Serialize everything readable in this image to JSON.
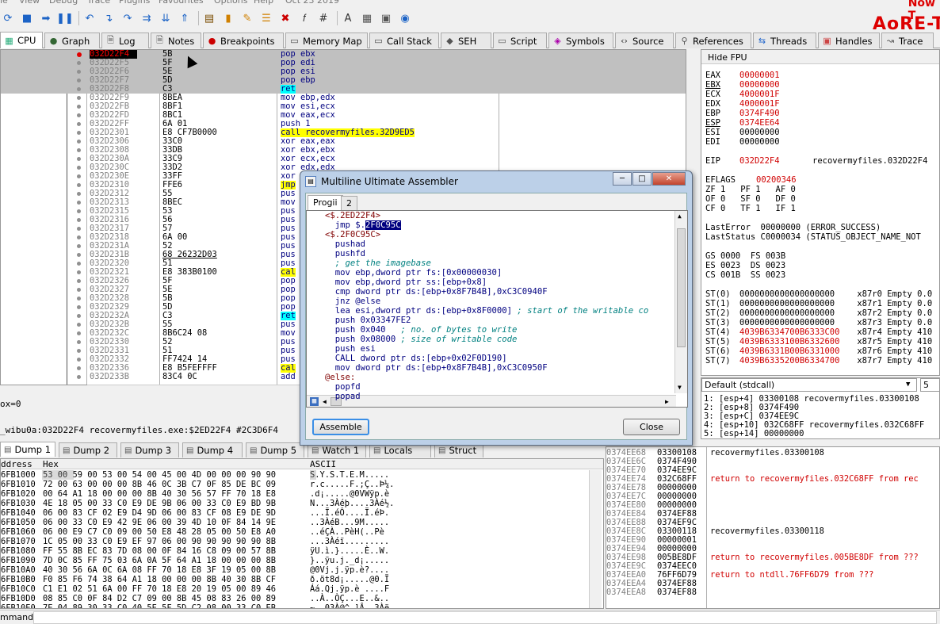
{
  "menubar": {
    "items": [
      "ie",
      "View",
      "Debug",
      "Trace",
      "Plugins",
      "Favourites",
      "Options",
      "Help",
      "Oct 23 2019"
    ]
  },
  "logo": {
    "line1": "Now T",
    "line2": "AoRE-T"
  },
  "toolbar": {
    "icons": [
      "refresh-icon",
      "stop-icon",
      "run-icon",
      "pause-icon",
      "restart-icon",
      "step-into-icon",
      "step-over-icon",
      "trace-icon",
      "animate-icon",
      "run-to-user-icon",
      "cpu-icon",
      "bookmark-icon",
      "comment-icon",
      "label-icon",
      "patch-icon",
      "function-icon",
      "hash-icon",
      "font-icon",
      "tools-icon",
      "calc-icon",
      "web-icon"
    ]
  },
  "tabs": [
    {
      "label": "CPU",
      "icon": "cpu-icon",
      "active": true
    },
    {
      "label": "Graph",
      "icon": "graph-icon"
    },
    {
      "label": "Log",
      "icon": "log-icon"
    },
    {
      "label": "Notes",
      "icon": "notes-icon"
    },
    {
      "label": "Breakpoints",
      "icon": "breakpoint-icon"
    },
    {
      "label": "Memory Map",
      "icon": "memory-icon"
    },
    {
      "label": "Call Stack",
      "icon": "callstack-icon"
    },
    {
      "label": "SEH",
      "icon": "seh-icon"
    },
    {
      "label": "Script",
      "icon": "script-icon"
    },
    {
      "label": "Symbols",
      "icon": "symbols-icon"
    },
    {
      "label": "Source",
      "icon": "source-icon"
    },
    {
      "label": "References",
      "icon": "references-icon"
    },
    {
      "label": "Threads",
      "icon": "threads-icon"
    },
    {
      "label": "Handles",
      "icon": "handles-icon"
    },
    {
      "label": "Trace",
      "icon": "trace-icon"
    }
  ],
  "disasm": {
    "eip_label": "P",
    "rows": [
      {
        "addr": "032D22F4",
        "bytes": "5B",
        "ins": "pop ebx",
        "sel": true,
        "cur": true
      },
      {
        "addr": "032D22F5",
        "bytes": "5F",
        "ins": "pop edi",
        "sel": true
      },
      {
        "addr": "032D22F6",
        "bytes": "5E",
        "ins": "pop esi",
        "sel": true
      },
      {
        "addr": "032D22F7",
        "bytes": "5D",
        "ins": "pop ebp",
        "sel": true
      },
      {
        "addr": "032D22F8",
        "bytes": "C3",
        "ins": "ret",
        "sel": true,
        "hl": "ret"
      },
      {
        "addr": "032D22F9",
        "bytes": "8BEA",
        "ins": "mov ebp,edx"
      },
      {
        "addr": "032D22FB",
        "bytes": "8BF1",
        "ins": "mov esi,ecx"
      },
      {
        "addr": "032D22FD",
        "bytes": "8BC1",
        "ins": "mov eax,ecx"
      },
      {
        "addr": "032D22FF",
        "bytes": "6A 01",
        "ins": "push 1"
      },
      {
        "addr": "032D2301",
        "bytes": "E8 CF7B0000",
        "ins": "call recovermyfiles.32D9ED5",
        "hl": "call"
      },
      {
        "addr": "032D2306",
        "bytes": "33C0",
        "ins": "xor eax,eax"
      },
      {
        "addr": "032D2308",
        "bytes": "33DB",
        "ins": "xor ebx,ebx"
      },
      {
        "addr": "032D230A",
        "bytes": "33C9",
        "ins": "xor ecx,ecx"
      },
      {
        "addr": "032D230C",
        "bytes": "33D2",
        "ins": "xor edx,edx"
      },
      {
        "addr": "032D230E",
        "bytes": "33FF",
        "ins": "xor"
      },
      {
        "addr": "032D2310",
        "bytes": "FFE6",
        "ins": "jmp",
        "hl": "jmp"
      },
      {
        "addr": "032D2312",
        "bytes": "55",
        "ins": "pus"
      },
      {
        "addr": "032D2313",
        "bytes": "8BEC",
        "ins": "mov"
      },
      {
        "addr": "032D2315",
        "bytes": "53",
        "ins": "pus"
      },
      {
        "addr": "032D2316",
        "bytes": "56",
        "ins": "pus"
      },
      {
        "addr": "032D2317",
        "bytes": "57",
        "ins": "pus"
      },
      {
        "addr": "032D2318",
        "bytes": "6A 00",
        "ins": "pus"
      },
      {
        "addr": "032D231A",
        "bytes": "52",
        "ins": "pus"
      },
      {
        "addr": "032D231B",
        "bytes": "68 26232D03",
        "ins": "pus",
        "ul": true
      },
      {
        "addr": "032D2320",
        "bytes": "51",
        "ins": "pus"
      },
      {
        "addr": "032D2321",
        "bytes": "E8 383B0100",
        "ins": "cal",
        "hl": "call"
      },
      {
        "addr": "032D2326",
        "bytes": "5F",
        "ins": "pop"
      },
      {
        "addr": "032D2327",
        "bytes": "5E",
        "ins": "pop"
      },
      {
        "addr": "032D2328",
        "bytes": "5B",
        "ins": "pop"
      },
      {
        "addr": "032D2329",
        "bytes": "5D",
        "ins": "pop"
      },
      {
        "addr": "032D232A",
        "bytes": "C3",
        "ins": "ret",
        "hl": "ret"
      },
      {
        "addr": "032D232B",
        "bytes": "55",
        "ins": "pus"
      },
      {
        "addr": "032D232C",
        "bytes": "8B6C24 08",
        "ins": "mov"
      },
      {
        "addr": "032D2330",
        "bytes": "52",
        "ins": "pus"
      },
      {
        "addr": "032D2331",
        "bytes": "51",
        "ins": "pus"
      },
      {
        "addr": "032D2332",
        "bytes": "FF7424 14",
        "ins": "pus"
      },
      {
        "addr": "032D2336",
        "bytes": "E8 B5FEFFFF",
        "ins": "cal",
        "hl": "call"
      },
      {
        "addr": "032D233B",
        "bytes": "83C4 0C",
        "ins": "add"
      }
    ]
  },
  "info": {
    "line1": "ox=0",
    "line2": "_wibu0a:032D22F4 recovermyfiles.exe:$2ED22F4 #2C3D6F4"
  },
  "registers": {
    "header": "Hide FPU",
    "gp": [
      {
        "name": "EAX",
        "val": "00000001"
      },
      {
        "name": "EBX",
        "val": "00000000",
        "ul": true
      },
      {
        "name": "ECX",
        "val": "4000001F"
      },
      {
        "name": "EDX",
        "val": "4000001F"
      },
      {
        "name": "EBP",
        "val": "0374F490"
      },
      {
        "name": "ESP",
        "val": "0374EE64",
        "ul": true
      },
      {
        "name": "ESI",
        "val": "00000000",
        "black": true
      },
      {
        "name": "EDI",
        "val": "00000000",
        "black": true
      }
    ],
    "eip": {
      "name": "EIP",
      "val": "032D22F4",
      "comment": "recovermyfiles.032D22F4"
    },
    "eflags": {
      "name": "EFLAGS",
      "val": "00200346"
    },
    "flags": [
      "ZF 1   PF 1   AF 0",
      "OF 0   SF 0   DF 0",
      "CF 0   TF 1   IF 1"
    ],
    "last_error": "LastError  00000000 (ERROR_SUCCESS)",
    "last_status": "LastStatus C0000034 (STATUS_OBJECT_NAME_NOT",
    "segs": [
      "GS 0000  FS 003B",
      "ES 0023  DS 0023",
      "CS 001B  SS 0023"
    ],
    "fpu": [
      {
        "name": "ST(0)",
        "val": "0000000000000000000",
        "rest": " x87r0 Empty 0.0",
        "black": true
      },
      {
        "name": "ST(1)",
        "val": "0000000000000000000",
        "rest": " x87r1 Empty 0.0",
        "black": true
      },
      {
        "name": "ST(2)",
        "val": "0000000000000000000",
        "rest": " x87r2 Empty 0.0",
        "black": true
      },
      {
        "name": "ST(3)",
        "val": "0000000000000000000",
        "rest": " x87r3 Empty 0.0",
        "black": true
      },
      {
        "name": "ST(4)",
        "val": "4039B6334700B6333C00",
        "rest": " x87r4 Empty 410"
      },
      {
        "name": "ST(5)",
        "val": "4039B6333100B6332600",
        "rest": " x87r5 Empty 410"
      },
      {
        "name": "ST(6)",
        "val": "4039B6331B00B6331000",
        "rest": " x87r6 Empty 410"
      },
      {
        "name": "ST(7)",
        "val": "4039B6335200B6334700",
        "rest": " x87r7 Empty 410"
      }
    ]
  },
  "callconv": {
    "selected": "Default (stdcall)",
    "count": "5",
    "lines": [
      "1: [esp+4] 03300108 recovermyfiles.03300108",
      "2: [esp+8] 0374F490",
      "3: [esp+C] 0374EE9C",
      "4: [esp+10] 032C68FF recovermyfiles.032C68FF",
      "5: [esp+14] 00000000"
    ]
  },
  "dump_tabs": [
    {
      "label": "Dump 1",
      "active": true
    },
    {
      "label": "Dump 2"
    },
    {
      "label": "Dump 3"
    },
    {
      "label": "Dump 4"
    },
    {
      "label": "Dump 5"
    },
    {
      "label": "Watch 1"
    },
    {
      "label": "Locals"
    },
    {
      "label": "Struct"
    }
  ],
  "dump": {
    "headers": {
      "address": "ddress",
      "hex": "Hex",
      "ascii": "ASCII"
    },
    "rows": [
      {
        "a": "6FB1000",
        "h": "53 00 59 00 53 00 54 00 45 00 4D 00 00 00 90 90",
        "s": "S.Y.S.T.E.M....."
      },
      {
        "a": "6FB1010",
        "h": "72 00 63 00 00 00 8B 46 0C 3B C7 0F 85 DE BC 09",
        "s": "r.c.....F.;Ç..Þ¼."
      },
      {
        "a": "6FB1020",
        "h": "00 64 A1 18 00 00 00 8B 40 30 56 57 FF 70 18 E8",
        "s": ".d¡.....@0VWÿp.è"
      },
      {
        "a": "6FB1030",
        "h": "4E 18 05 00 33 C0 E9 DE 9B 06 00 33 C0 E9 BD 9B",
        "s": "N...3Àéþ....3Àé½."
      },
      {
        "a": "6FB1040",
        "h": "06 00 83 CF 02 E9 D4 9D 06 00 83 CF 08 E9 DE 9D",
        "s": "...Ï.éÔ....Ï.éÞ."
      },
      {
        "a": "6FB1050",
        "h": "06 00 33 C0 E9 42 9E 06 00 39 4D 10 0F 84 14 9E",
        "s": "..3ÀéB...9M....."
      },
      {
        "a": "6FB1060",
        "h": "06 00 E9 C7 C0 09 00 50 E8 48 28 05 00 50 E8 A0",
        "s": "..éÇÀ..PèH(..Pè "
      },
      {
        "a": "6FB1070",
        "h": "1C 05 00 33 C0 E9 EF 97 06 00 90 90 90 90 90 8B",
        "s": "...3Àéï........."
      },
      {
        "a": "6FB1080",
        "h": "FF 55 8B EC 83 7D 08 00 0F 84 16 C8 09 00 57 8B",
        "s": "ÿU.ì.}.....È..W."
      },
      {
        "a": "6FB1090",
        "h": "7D 0C 85 FF 75 03 6A 0A 5F 64 A1 18 00 00 00 8B",
        "s": "}..ÿu.j._d¡....."
      },
      {
        "a": "6FB10A0",
        "h": "40 30 56 6A 0C 6A 08 FF 70 18 E8 3F 19 05 00 8B",
        "s": "@0Vj.j.ÿp.è?...."
      },
      {
        "a": "6FB10B0",
        "h": "F0 85 F6 74 38 64 A1 18 00 00 00 8B 40 30 8B CF",
        "s": "ð.öt8d¡.....@0.Ï"
      },
      {
        "a": "6FB10C0",
        "h": "C1 E1 02 51 6A 00 FF 70 18 E8 20 19 05 00 89 46",
        "s": "Áá.Qj.ÿp.è ....F"
      },
      {
        "a": "6FB10D0",
        "h": "08 85 C0 0F 84 D2 C7 09 00 8B 45 08 83 26 00 89",
        "s": "..À..ÒÇ...E..&.."
      },
      {
        "a": "6FB10E0",
        "h": "7E 04 89 30 33 C0 40 5E 5F 5D C2 08 00 33 C0 EB",
        "s": "~..03À@^_]Â..3Àë"
      }
    ]
  },
  "stack": {
    "rows": [
      {
        "a": "0374EE68",
        "v": "03300108",
        "c": "recovermyfiles.03300108",
        "t": "black"
      },
      {
        "a": "0374EE6C",
        "v": "0374F490",
        "c": ""
      },
      {
        "a": "0374EE70",
        "v": "0374EE9C",
        "c": ""
      },
      {
        "a": "0374EE74",
        "v": "032C68FF",
        "c": "return to recovermyfiles.032C68FF from rec",
        "t": "red"
      },
      {
        "a": "0374EE78",
        "v": "00000000",
        "c": ""
      },
      {
        "a": "0374EE7C",
        "v": "00000000",
        "c": ""
      },
      {
        "a": "0374EE80",
        "v": "00000000",
        "c": ""
      },
      {
        "a": "0374EE84",
        "v": "0374EF88",
        "c": ""
      },
      {
        "a": "0374EE88",
        "v": "0374EF9C",
        "c": ""
      },
      {
        "a": "0374EE8C",
        "v": "03300118",
        "c": "recovermyfiles.03300118",
        "t": "black"
      },
      {
        "a": "0374EE90",
        "v": "00000001",
        "c": ""
      },
      {
        "a": "0374EE94",
        "v": "00000000",
        "c": ""
      },
      {
        "a": "0374EE98",
        "v": "005BE8DF",
        "c": "return to recovermyfiles.005BE8DF from ???",
        "t": "red"
      },
      {
        "a": "0374EE9C",
        "v": "0374EEC0",
        "c": ""
      },
      {
        "a": "0374EEA0",
        "v": "76FF6D79",
        "c": "return to ntdll.76FF6D79 from ???",
        "t": "red"
      },
      {
        "a": "0374EEA4",
        "v": "0374EF88",
        "c": ""
      },
      {
        "a": "0374EEA8",
        "v": "0374EF88",
        "c": ""
      }
    ]
  },
  "command": {
    "label": "mmand:"
  },
  "dialog": {
    "title": "Multiline Ultimate Assembler",
    "tabs": [
      "Progii",
      "2"
    ],
    "lines": [
      {
        "t": "lbl",
        "x": "<$.2ED22F4>"
      },
      {
        "t": "code",
        "x": "  jmp $.",
        "k": "2F0C95C"
      },
      {
        "t": "lbl",
        "x": "<$.2F0C95C>"
      },
      {
        "t": "code",
        "x": "  pushad"
      },
      {
        "t": "code",
        "x": "  pushfd"
      },
      {
        "t": "cmt",
        "x": "  ; get the imagebase"
      },
      {
        "t": "code",
        "x": "  mov ebp,dword ptr fs:[0x00000030]"
      },
      {
        "t": "code",
        "x": "  mov ebp,dword ptr ss:[ebp+0x8]"
      },
      {
        "t": "code",
        "x": "  cmp dword ptr ds:[ebp+0x8F7B4B],0xC3C0940F"
      },
      {
        "t": "code",
        "x": "  jnz @else"
      },
      {
        "t": "mix",
        "x": "  lea esi,dword ptr ds:[ebp+0x8F0000]",
        "c": " ; start of the writable co"
      },
      {
        "t": "code",
        "x": "  push 0x03347FE2"
      },
      {
        "t": "mix",
        "x": "  push 0x040",
        "c": "   ; no. of bytes to write"
      },
      {
        "t": "mix",
        "x": "  push 0x08000",
        "c": " ; size of writable code"
      },
      {
        "t": "code",
        "x": "  push esi"
      },
      {
        "t": "code",
        "x": "  CALL dword ptr ds:[ebp+0x02F0D190]"
      },
      {
        "t": "code",
        "x": "  mov dword ptr ds:[ebp+0x8F7B4B],0xC3C0950F"
      },
      {
        "t": "lbl",
        "x": "@else:"
      },
      {
        "t": "code",
        "x": "  popfd"
      },
      {
        "t": "code",
        "x": "  popad"
      }
    ],
    "assemble_label": "Assemble",
    "close_label": "Close"
  }
}
